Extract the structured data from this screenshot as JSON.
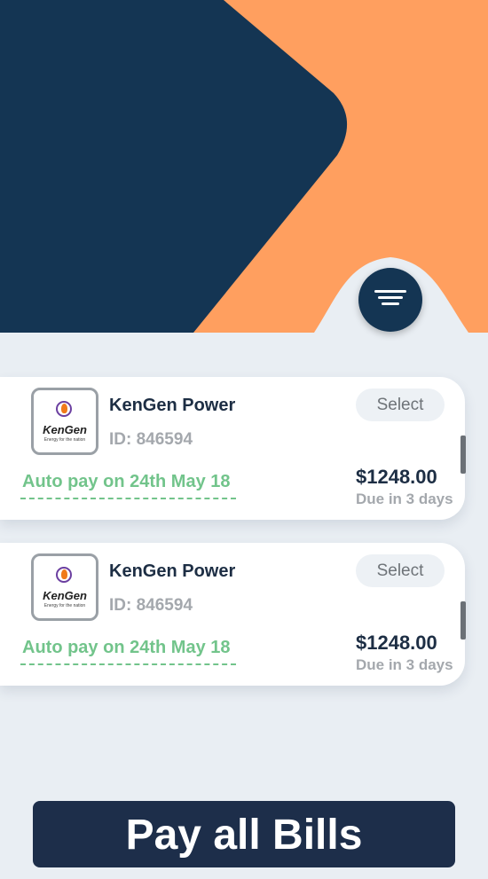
{
  "theme": {
    "navy": "#143553",
    "orange": "#ff9f5f",
    "accent_green": "#72c48b",
    "background": "#e9eef3"
  },
  "header": {
    "filter_icon": "filter-icon"
  },
  "bills": [
    {
      "company": "KenGen Power",
      "logo_text": "KenGen",
      "logo_tagline": "Energy for the nation",
      "id_text": "ID: 846594",
      "select_label": "Select",
      "autopay_text": "Auto pay on 24th May 18",
      "amount": "$1248.00",
      "due_text": "Due in 3 days"
    },
    {
      "company": "KenGen Power",
      "logo_text": "KenGen",
      "logo_tagline": "Energy for the nation",
      "id_text": "ID: 846594",
      "select_label": "Select",
      "autopay_text": "Auto pay on 24th May 18",
      "amount": "$1248.00",
      "due_text": "Due in 3 days"
    }
  ],
  "footer": {
    "pay_all_label": "Pay all Bills"
  }
}
